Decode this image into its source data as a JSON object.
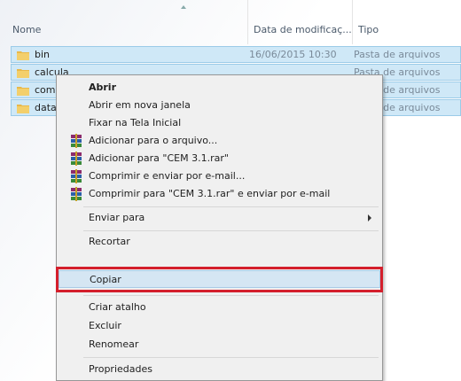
{
  "columns": {
    "name": "Nome",
    "date": "Data de modificaç...",
    "type": "Tipo"
  },
  "files": [
    {
      "name": "bin",
      "date": "16/06/2015 10:30",
      "type": "Pasta de arquivos"
    },
    {
      "name": "calcula",
      "date": "",
      "type": "Pasta de arquivos"
    },
    {
      "name": "comu",
      "date": "",
      "type": "Pasta de arquivos"
    },
    {
      "name": "datab",
      "date": "",
      "type": "Pasta de arquivos"
    }
  ],
  "menu": {
    "open": "Abrir",
    "open_new_window": "Abrir em nova janela",
    "pin_start": "Fixar na Tela Inicial",
    "add_archive": "Adicionar para o arquivo...",
    "add_rar": "Adicionar para \"CEM 3.1.rar\"",
    "compress_email": "Comprimir e enviar por e-mail...",
    "compress_rar_email": "Comprimir para \"CEM 3.1.rar\" e enviar por e-mail",
    "send_to": "Enviar para",
    "cut": "Recortar",
    "copy": "Copiar",
    "create_shortcut": "Criar atalho",
    "delete": "Excluir",
    "rename": "Renomear",
    "properties": "Propriedades"
  },
  "colors": {
    "selection": "#cfe8f7",
    "menu_bg": "#f0f0f0",
    "highlight": "#d5e6f3",
    "focus_box": "#d41f2c"
  }
}
